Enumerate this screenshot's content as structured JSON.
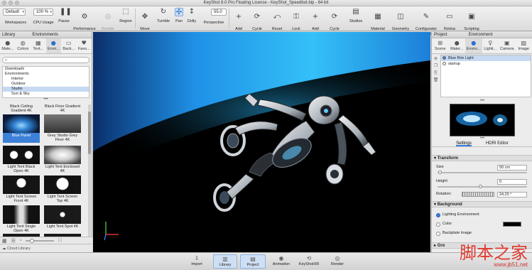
{
  "window": {
    "title": "KeyShot 8.0 Pro Floating License - KeyShot_Speedbot.bip - 64 bit"
  },
  "toolbar": {
    "workspaces_value": "Default",
    "workspaces_label": "Workspaces",
    "cpu_value": "100 %",
    "cpu_label": "CPU Usage",
    "pause": "Pause",
    "performance_mode": "Performance\nMode",
    "render_nurbs": "Render\nNURBS",
    "region": "Region",
    "move_tool": "Move\nTool",
    "tumble": "Tumble",
    "pan": "Pan",
    "dolly": "Dolly",
    "perspective_value": "55,0",
    "perspective": "Perspective",
    "add_camera": "Add\nCamera",
    "cycle_cameras": "Cycle\nCameras",
    "reset_camera": "Reset\nCamera",
    "lock_camera": "Lock\nCamera",
    "add_studio": "Add\nStudio",
    "cycle_studios": "Cycle\nStudios",
    "studios": "Studios",
    "material_templates": "Material\nTemplates",
    "geometry_view": "Geometry\nView",
    "configurator_wizard": "Configurator\nWizard",
    "retina_mode": "Retina\nMode",
    "scripting_console": "Scripting\nConsole"
  },
  "library": {
    "header": "Library",
    "section": "Environments",
    "tabs": [
      "Mate...",
      "Colors",
      "Text...",
      "Envir...",
      "Back...",
      "Favo..."
    ],
    "search_placeholder": "",
    "tree": [
      "Downloads",
      "Environments",
      "Interior",
      "Outdoor",
      "Studio",
      "Sun & Sky"
    ],
    "thumbnails": [
      "Black Ceiling Gradient 4K",
      "Black Floor Gradient 4K",
      "Blue Panel",
      "Grey Studio Grey Floor 4K",
      "Light Tent Black Open 4K",
      "Light Tent Enclosed 4K",
      "Light Tent Screen Front 4K",
      "Light Tent Screen Top 4K",
      "Light Tent Single Open 4K",
      "Light Tent Spot 4K"
    ],
    "cloud_library": "Cloud Library"
  },
  "project": {
    "header": "Project",
    "section": "Environment",
    "tabs": [
      "Scene",
      "Mater...",
      "Enviro...",
      "Lighti...",
      "Camera",
      "Image"
    ],
    "list": [
      "Blue Rim Light",
      "startup"
    ],
    "subtabs": [
      "Settings",
      "HDRI Editor"
    ],
    "transform": {
      "title": "Transform",
      "size_label": "Size",
      "size_value": "50 cm",
      "height_label": "Height",
      "height_value": "0",
      "rotation_label": "Rotation:",
      "rotation_value": "24,25 °"
    },
    "background": {
      "title": "Background",
      "options": [
        "Lighting Environment",
        "Color",
        "Backplate Image"
      ],
      "selected": "Lighting Environment"
    },
    "ground_partial": "Gro"
  },
  "bottombar": {
    "items": [
      "Import",
      "Library",
      "Project",
      "Animation",
      "KeyShotXR",
      "Render"
    ],
    "selected": [
      "Library",
      "Project"
    ]
  },
  "watermark": {
    "big": "脚本之家",
    "small": "www.jb51.net"
  },
  "colors": {
    "accent": "#3d80d8",
    "viewport_blue": "#2fb4f5"
  }
}
